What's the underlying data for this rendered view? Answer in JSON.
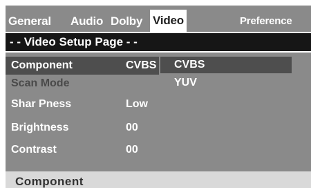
{
  "tabs": [
    {
      "label": "General"
    },
    {
      "label": "Audio"
    },
    {
      "label": "Dolby"
    },
    {
      "label": "Video"
    },
    {
      "label": "Preference"
    }
  ],
  "page_title": "- - Video Setup Page - -",
  "menu": [
    {
      "label": "Component",
      "value": "CVBS"
    },
    {
      "label": "Scan Mode",
      "value": ""
    },
    {
      "label": "Shar Pness",
      "value": "Low"
    },
    {
      "label": "Brightness",
      "value": "00"
    },
    {
      "label": "Contrast",
      "value": "00"
    }
  ],
  "submenu": [
    {
      "label": "CVBS"
    },
    {
      "label": "YUV"
    }
  ],
  "help_text": "Component",
  "colors": {
    "menu_bg": "#8a8a8a",
    "title_bg": "#161616",
    "highlight": "#4e4e4e",
    "active_tab": "#ffffff",
    "help_bg": "#d9d9d9"
  }
}
